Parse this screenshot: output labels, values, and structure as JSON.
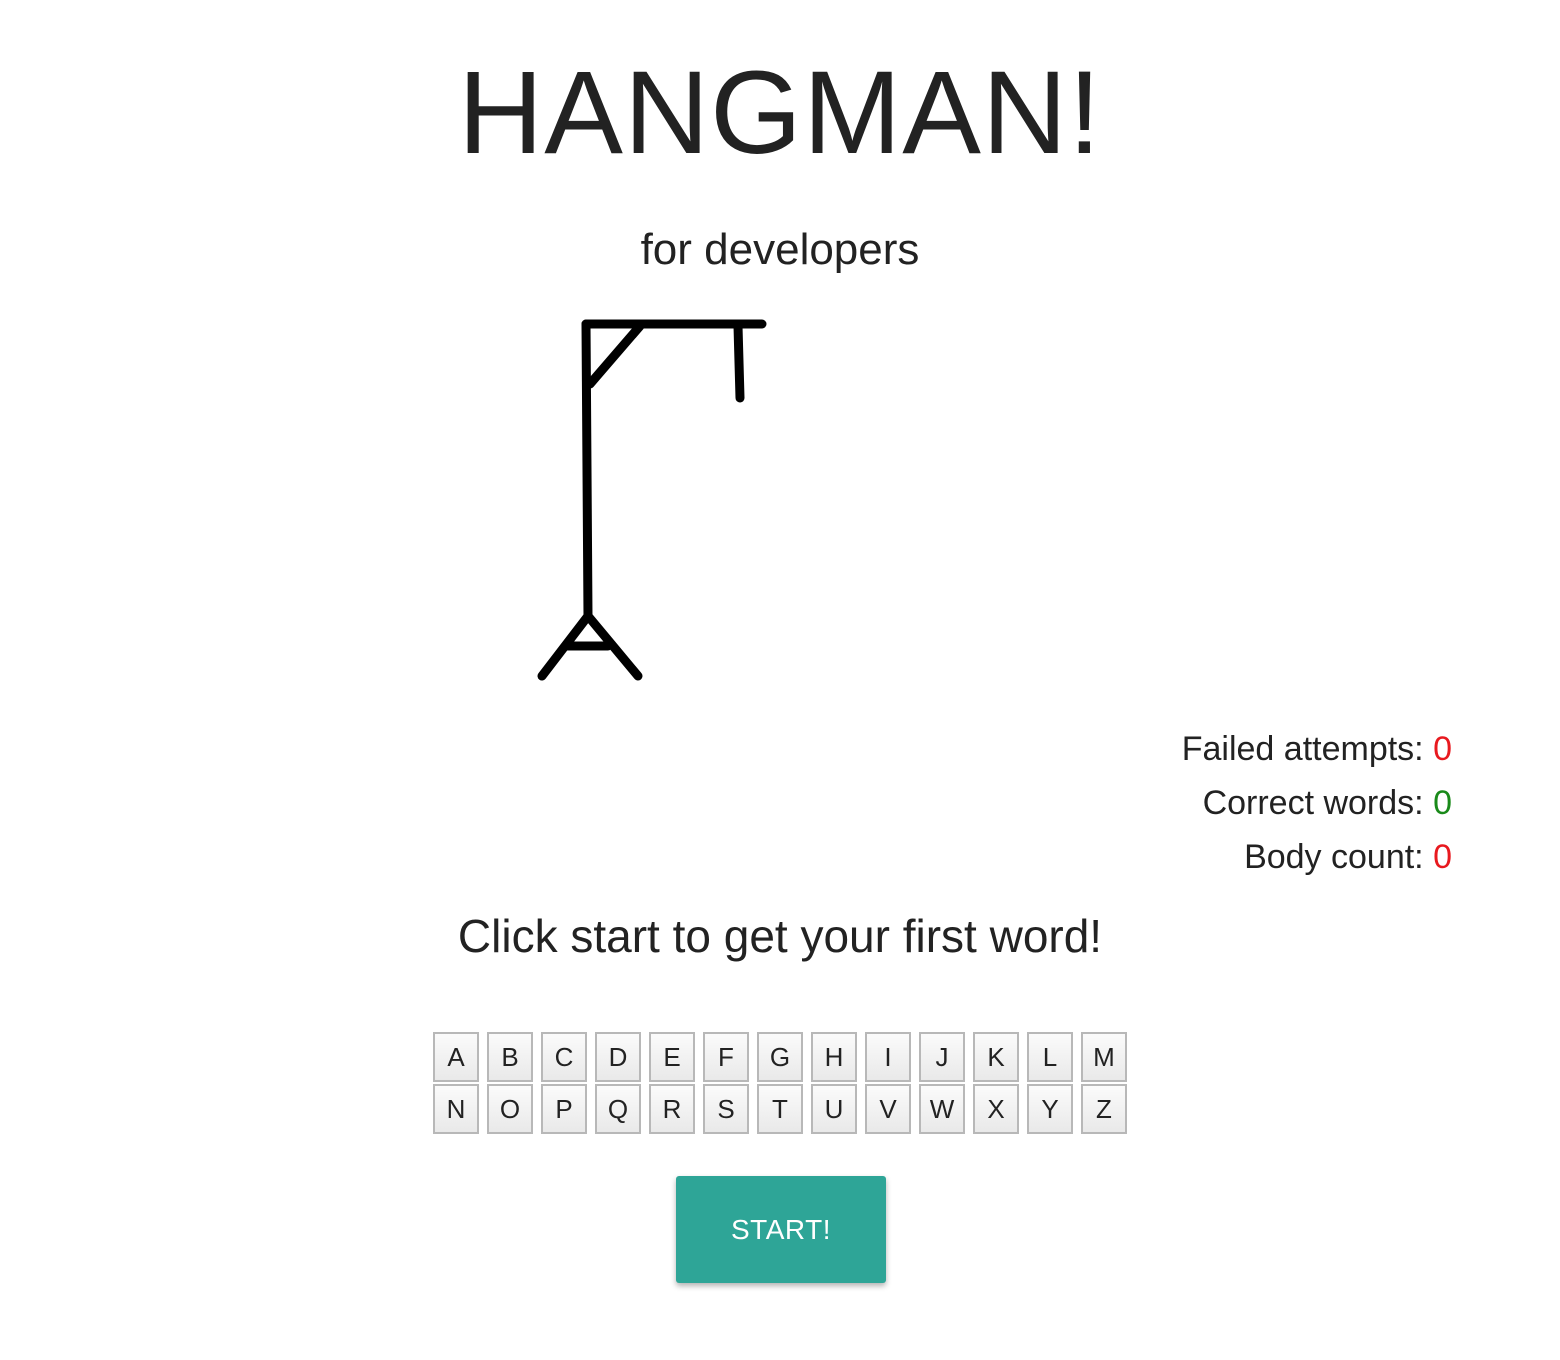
{
  "header": {
    "title": "HANGMAN!",
    "subtitle": "for developers"
  },
  "stats": {
    "failed_label": "Failed attempts:",
    "failed_value": "0",
    "correct_label": "Correct words:",
    "correct_value": "0",
    "body_label": "Body count:",
    "body_value": "0",
    "colors": {
      "failed": "#e8191f",
      "correct": "#1a8a1a",
      "body": "#e8191f"
    }
  },
  "message": "Click start to get your first word!",
  "keyboard": {
    "row1": [
      "A",
      "B",
      "C",
      "D",
      "E",
      "F",
      "G",
      "H",
      "I",
      "J",
      "K",
      "L",
      "M"
    ],
    "row2": [
      "N",
      "O",
      "P",
      "Q",
      "R",
      "S",
      "T",
      "U",
      "V",
      "W",
      "X",
      "Y",
      "Z"
    ]
  },
  "start_button": {
    "label": "START!",
    "color": "#2ea597"
  }
}
